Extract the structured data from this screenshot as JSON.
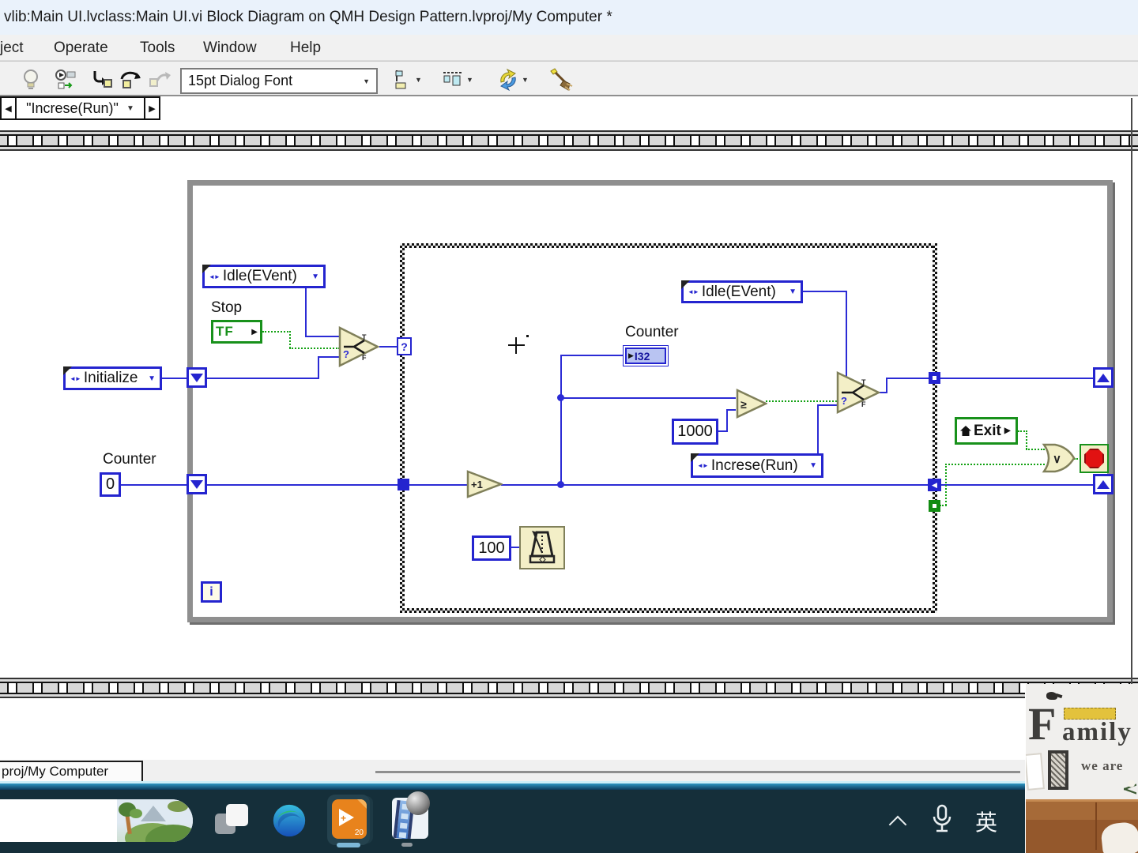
{
  "window": {
    "title": "vlib:Main UI.lvclass:Main UI.vi Block Diagram on QMH Design Pattern.lvproj/My Computer *"
  },
  "menu": {
    "items": [
      "ject",
      "Operate",
      "Tools",
      "Window",
      "Help"
    ]
  },
  "toolbar": {
    "font_selector": "15pt Dialog Font"
  },
  "icons": {
    "down_arrow": "▼",
    "left_arrow": "◀",
    "right_arrow": "▶",
    "terminal_arrow": "▶",
    "enum_glyph": "◄►"
  },
  "diagram": {
    "case_selector": "\"Increse(Run)\"",
    "enum_idle_left": "Idle(EVent)",
    "enum_idle_case": "Idle(EVent)",
    "enum_initialize": "Initialize",
    "enum_increse": "Increse(Run)",
    "label_stop": "Stop",
    "label_counter_left": "Counter",
    "label_counter_case": "Counter",
    "const_counter_init": "0",
    "const_compare": "1000",
    "const_wait_ms": "100",
    "tf_terminal": "TF",
    "i32_terminal": "I32",
    "iteration_terminal": "i",
    "case_question": "?",
    "select_q": "?",
    "select_t": "T",
    "select_f": "F",
    "gte_glyph": "≥",
    "increment_glyph": "+1",
    "exit_label": "Exit",
    "or_glyph": "∨"
  },
  "statusbar": {
    "target_tab": "proj/My Computer"
  },
  "taskbar": {
    "ime_label": "英",
    "potplayer_badge": "20"
  },
  "overlay_photo": {
    "f_initial": "F",
    "family_rest": "amily",
    "we_are": "we are"
  },
  "colors": {
    "labview_blue": "#2B2BD5",
    "labview_green": "#18911B",
    "node_fill": "#F3EFC7",
    "loop_border": "#8F8F8F",
    "case_checker": "#101010",
    "taskbar_bg": "#152F3A",
    "accent_cyan": "#2E96C3",
    "stop_red": "#DD1111",
    "potplayer_orange": "#E8831C"
  }
}
